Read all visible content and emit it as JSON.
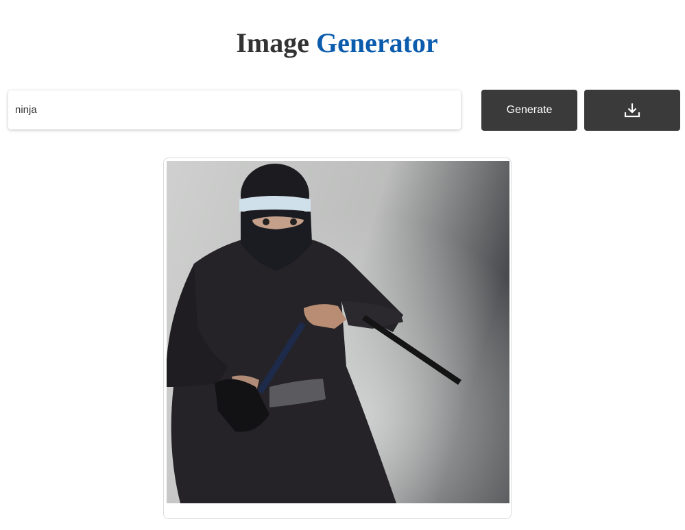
{
  "header": {
    "title_plain": "Image",
    "title_accent": "Generator"
  },
  "prompt": {
    "value": "ninja",
    "placeholder": ""
  },
  "buttons": {
    "generate_label": "Generate",
    "download_icon": "download-icon"
  },
  "result": {
    "alt": "ninja"
  },
  "colors": {
    "accent": "#0b5cad",
    "title_text": "#333333",
    "button_bg": "#3a3a3a"
  }
}
